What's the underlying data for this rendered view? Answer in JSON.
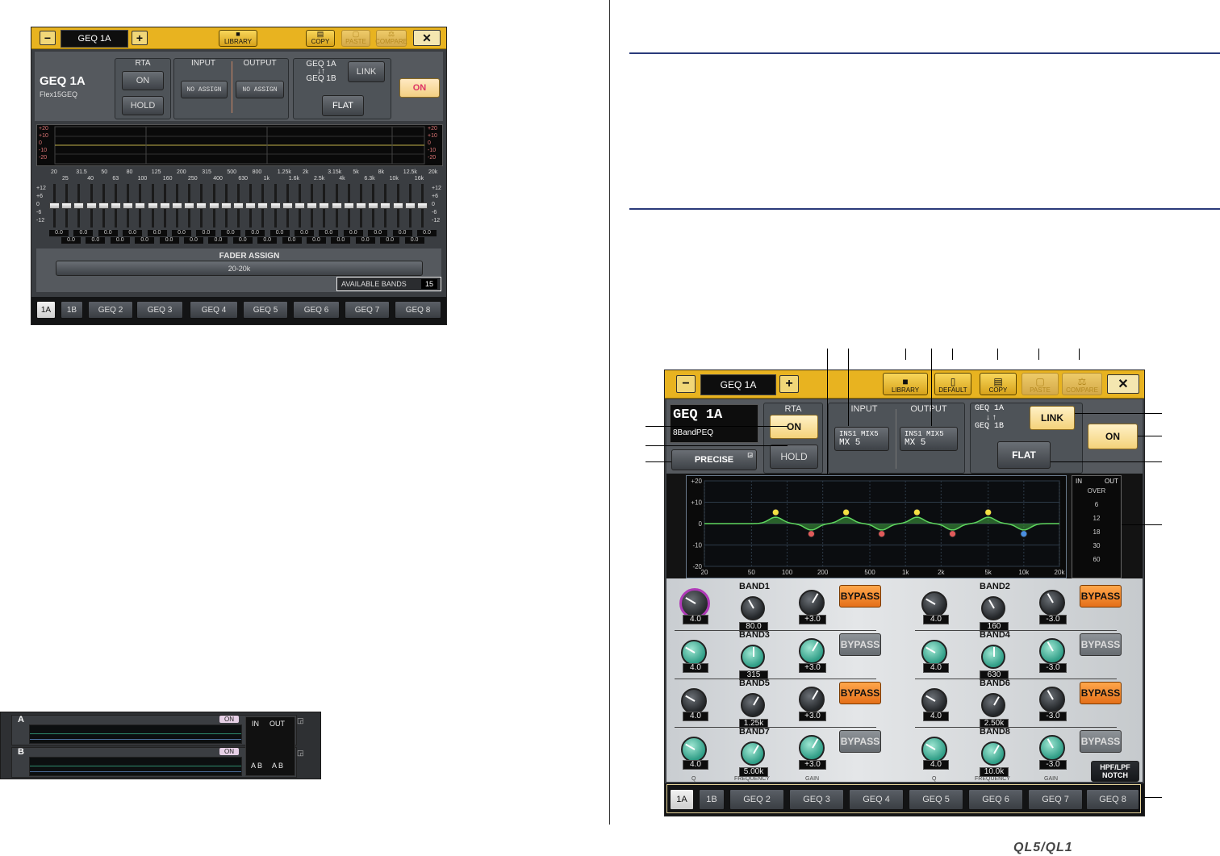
{
  "left_panel": {
    "name_tab": "GEQ 1A",
    "library_label": "LIBRARY",
    "copy_label": "COPY",
    "paste_label": "PASTE",
    "compare_label": "COMPARE",
    "title": "GEQ 1A",
    "subtitle": "Flex15GEQ",
    "rta_label": "RTA",
    "rta_on": "ON",
    "rta_hold": "HOLD",
    "input_label": "INPUT",
    "output_label": "OUTPUT",
    "input_value": "NO ASSIGN",
    "output_value": "NO ASSIGN",
    "link_top": "GEQ 1A",
    "link_arrows": "↓↑",
    "link_bottom": "GEQ 1B",
    "link_label": "LINK",
    "flat_label": "FLAT",
    "on_label": "ON",
    "graph_scale": [
      "+20",
      "+10",
      "0",
      "-10",
      "-20"
    ],
    "freq_top": [
      "20",
      "31.5",
      "50",
      "80",
      "125",
      "200",
      "315",
      "500",
      "800",
      "1.25k",
      "2k",
      "3.15k",
      "5k",
      "8k",
      "12.5k",
      "20k"
    ],
    "freq_bottom": [
      "25",
      "40",
      "63",
      "100",
      "160",
      "250",
      "400",
      "630",
      "1k",
      "1.6k",
      "2.5k",
      "4k",
      "6.3k",
      "10k",
      "16k"
    ],
    "fader_scale": [
      "+12",
      "+6",
      "0",
      "-6",
      "-12"
    ],
    "fader_value": "0.0",
    "fader_assign_label": "FADER ASSIGN",
    "fader_assign_value": "20-20k",
    "available_bands_label": "AVAILABLE BANDS",
    "available_bands_value": "15",
    "tabs": [
      "1A",
      "1B",
      "GEQ 2",
      "GEQ 3",
      "GEQ 4",
      "GEQ 5",
      "GEQ 6",
      "GEQ 7",
      "GEQ 8"
    ]
  },
  "rack": {
    "unit_a_label": "A",
    "unit_b_label": "B",
    "unit_on": "ON",
    "in_label": "IN",
    "out_label": "OUT",
    "ab_in": "A B",
    "ab_out": "A B"
  },
  "right_panel": {
    "name_tab": "GEQ 1A",
    "library_label": "LIBRARY",
    "default_label": "DEFAULT",
    "copy_label": "COPY",
    "paste_label": "PASTE",
    "compare_label": "COMPARE",
    "title": "GEQ 1A",
    "subtitle": "8BandPEQ",
    "rta_label": "RTA",
    "rta_on": "ON",
    "rta_hold": "HOLD",
    "precise_label": "PRECISE",
    "input_label": "INPUT",
    "output_label": "OUTPUT",
    "input_line1": "INS1 MIX5",
    "input_line2": "MX 5",
    "output_line1": "INS1 MIX5",
    "output_line2": "MX 5",
    "link_top": "GEQ 1A",
    "link_arrows": "↓ ↑",
    "link_bottom": "GEQ 1B",
    "link_label": "LINK",
    "on_label": "ON",
    "flat_label": "FLAT",
    "graph_y": [
      "+20",
      "+10",
      "0",
      "-10",
      "-20"
    ],
    "graph_x": [
      "20",
      "50",
      "100",
      "200",
      "500",
      "1k",
      "2k",
      "5k",
      "10k",
      "20k"
    ],
    "meter_in": "IN",
    "meter_out": "OUT",
    "meter_scale": [
      "OVER",
      "6",
      "12",
      "18",
      "30",
      "60"
    ],
    "bands": [
      {
        "name": "BAND1",
        "q": "4.0",
        "freq": "80.0",
        "gain": "+3.0",
        "bypass": "BYPASS",
        "bypass_on": true
      },
      {
        "name": "BAND2",
        "q": "4.0",
        "freq": "160",
        "gain": "-3.0",
        "bypass": "BYPASS",
        "bypass_on": true
      },
      {
        "name": "BAND3",
        "q": "4.0",
        "freq": "315",
        "gain": "+3.0",
        "bypass": "BYPASS",
        "bypass_on": false
      },
      {
        "name": "BAND4",
        "q": "4.0",
        "freq": "630",
        "gain": "-3.0",
        "bypass": "BYPASS",
        "bypass_on": false
      },
      {
        "name": "BAND5",
        "q": "4.0",
        "freq": "1.25k",
        "gain": "+3.0",
        "bypass": "BYPASS",
        "bypass_on": true
      },
      {
        "name": "BAND6",
        "q": "4.0",
        "freq": "2.50k",
        "gain": "-3.0",
        "bypass": "BYPASS",
        "bypass_on": true
      },
      {
        "name": "BAND7",
        "q": "4.0",
        "freq": "5.00k",
        "gain": "+3.0",
        "bypass": "BYPASS",
        "bypass_on": false
      },
      {
        "name": "BAND8",
        "q": "4.0",
        "freq": "10.0k",
        "gain": "-3.0",
        "bypass": "BYPASS",
        "bypass_on": false
      }
    ],
    "col_q": "Q",
    "col_freq": "FREQUENCY",
    "col_gain": "GAIN",
    "hpf_line1": "HPF/LPF",
    "hpf_line2": "NOTCH",
    "tabs": [
      "1A",
      "1B",
      "GEQ 2",
      "GEQ 3",
      "GEQ 4",
      "GEQ 5",
      "GEQ 6",
      "GEQ 7",
      "GEQ 8"
    ]
  },
  "footer_logo": "QL5/QL1"
}
